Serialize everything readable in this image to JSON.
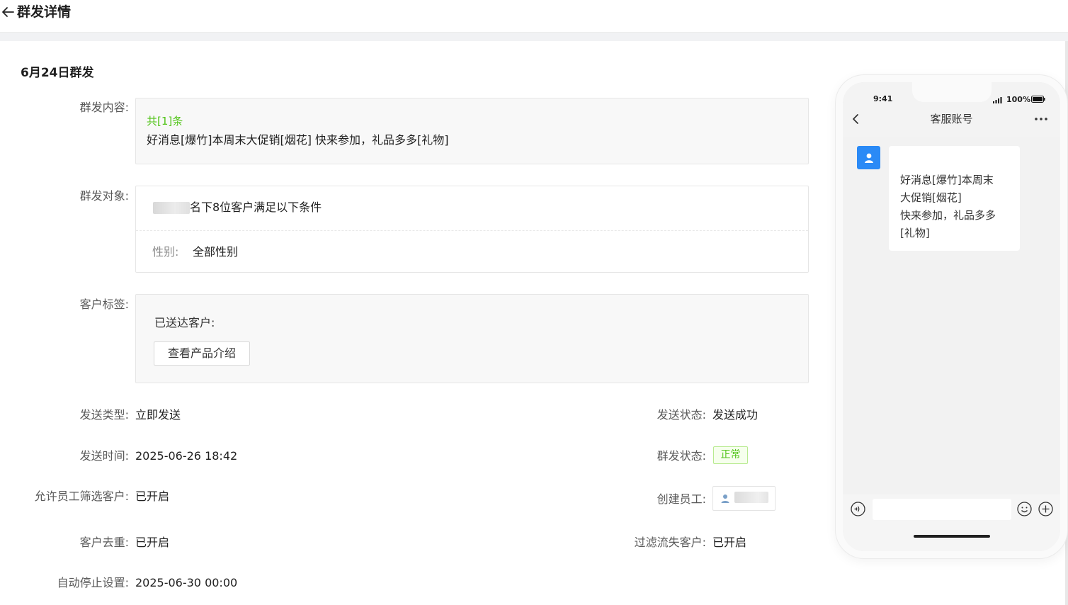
{
  "header": {
    "title": "群发详情"
  },
  "section": {
    "title": "6月24日群发"
  },
  "content": {
    "label": "群发内容:",
    "count": "共[1]条",
    "text": "好消息[爆竹]本周末大促销[烟花] 快来参加，礼品多多[礼物]"
  },
  "target": {
    "label": "群发对象:",
    "condition": "名下8位客户满足以下条件",
    "gender_label": "性别:",
    "gender_value": "全部性别"
  },
  "tags": {
    "label": "客户标签:",
    "sent_label": "已送达客户:",
    "tag_button": "查看产品介绍"
  },
  "details": {
    "send_type_label": "发送类型:",
    "send_type": "立即发送",
    "send_time_label": "发送时间:",
    "send_time": "2025-06-26 18:42",
    "allow_filter_label": "允许员工筛选客户:",
    "allow_filter": "已开启",
    "dedupe_label": "客户去重:",
    "dedupe": "已开启",
    "auto_stop_label": "自动停止设置:",
    "auto_stop": "2025-06-30 00:00",
    "send_status_label": "发送状态:",
    "send_status": "发送成功",
    "mass_status_label": "群发状态:",
    "mass_status": "正常",
    "creator_label": "创建员工:",
    "filter_lost_label": "过滤流失客户:",
    "filter_lost": "已开启"
  },
  "phone": {
    "time": "9:41",
    "battery": "100%",
    "chat_title": "客服账号",
    "message": "好消息[爆竹]本周末\n大促销[烟花]\n快来参加，礼品多多\n[礼物]"
  },
  "colors": {
    "success": "#52c41a",
    "avatar": "#2a8af6"
  }
}
